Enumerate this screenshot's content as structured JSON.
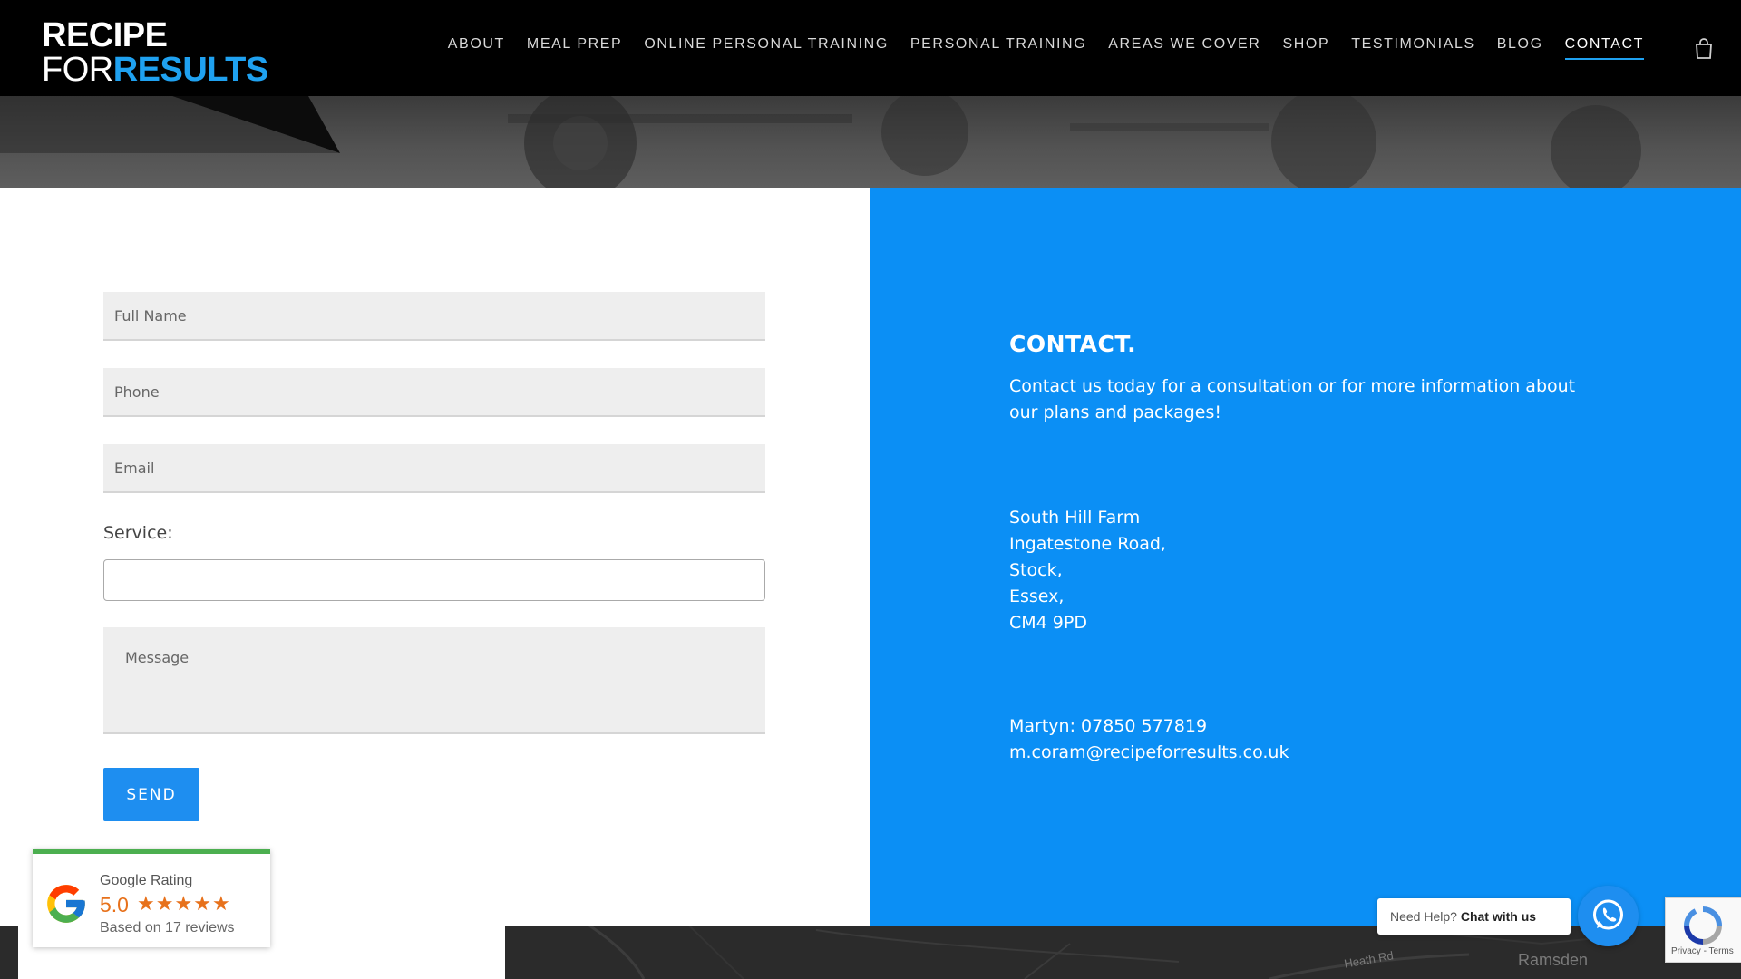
{
  "brand": {
    "line1": "RECIPE",
    "line2_a": "FOR",
    "line2_b": "RESULTS"
  },
  "nav": {
    "items": [
      "ABOUT",
      "MEAL PREP",
      "ONLINE PERSONAL TRAINING",
      "PERSONAL TRAINING",
      "AREAS WE COVER",
      "SHOP",
      "TESTIMONIALS",
      "BLOG",
      "CONTACT"
    ],
    "active": "CONTACT"
  },
  "icons": {
    "cart": "shopping-bag-icon",
    "whatsapp": "whatsapp-icon",
    "google": "google-g-icon",
    "recaptcha": "recaptcha-icon"
  },
  "form": {
    "full_name_placeholder": "Full Name",
    "phone_placeholder": "Phone",
    "email_placeholder": "Email",
    "service_label": "Service:",
    "service_value": "",
    "message_placeholder": "Message",
    "send_label": "SEND"
  },
  "contact": {
    "title": "CONTACT.",
    "intro": "Contact us today for a consultation or for more information about our plans and packages!",
    "address": [
      "South Hill Farm",
      "Ingatestone Road,",
      "Stock,",
      "Essex,",
      "CM4 9PD"
    ],
    "phone": "Martyn: 07850 577819",
    "email": "m.coram@recipeforresults.co.uk"
  },
  "rating": {
    "title": "Google Rating",
    "score": "5.0",
    "stars": 5,
    "reviews": "Based on 17 reviews"
  },
  "chat": {
    "prefix": "Need Help?",
    "cta": "Chat with us"
  },
  "recaptcha": {
    "privacy": "Privacy",
    "separator": " - ",
    "terms": "Terms"
  },
  "map": {
    "place": "Ramsden",
    "road": "Heath Rd"
  },
  "colors": {
    "accent": "#1fa1f0",
    "panel_blue": "#0b8ff5",
    "button_blue": "#1e8ef0",
    "header_bg": "#000000",
    "star_orange": "#e7711b",
    "rating_green": "#4caf50"
  }
}
